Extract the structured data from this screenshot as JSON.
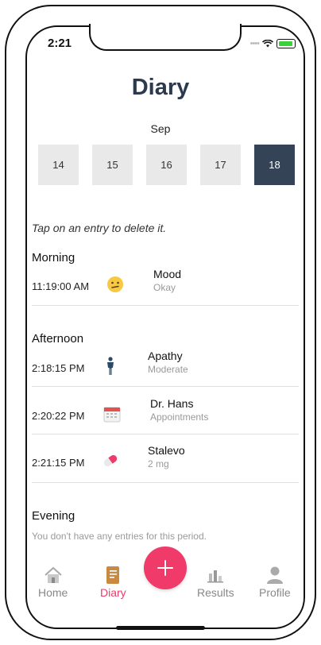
{
  "status": {
    "time": "2:21"
  },
  "header": {
    "title": "Diary",
    "month": "Sep"
  },
  "dates": [
    "14",
    "15",
    "16",
    "17",
    "18"
  ],
  "selected_date": "18",
  "hint": "Tap on an entry to delete it.",
  "sections": {
    "morning": {
      "title": "Morning",
      "entries": [
        {
          "time": "11:19:00 AM",
          "name": "Mood",
          "detail": "Okay",
          "icon": "neutral-face-icon"
        }
      ]
    },
    "afternoon": {
      "title": "Afternoon",
      "entries": [
        {
          "time": "2:18:15 PM",
          "name": "Apathy",
          "detail": "Moderate",
          "icon": "standing-person-icon"
        },
        {
          "time": "2:20:22 PM",
          "name": "Dr. Hans",
          "detail": "Appointments",
          "icon": "calendar-icon"
        },
        {
          "time": "2:21:15 PM",
          "name": "Stalevo",
          "detail": "2 mg",
          "icon": "pill-icon"
        }
      ]
    },
    "evening": {
      "title": "Evening",
      "empty_text": "You don't have any entries for this period."
    }
  },
  "tabbar": {
    "home": "Home",
    "diary": "Diary",
    "results": "Results",
    "profile": "Profile",
    "add_icon": "plus-icon"
  },
  "colors": {
    "accent": "#ef3a6a",
    "selected_date_bg": "#344356",
    "title": "#2c3a4e"
  }
}
